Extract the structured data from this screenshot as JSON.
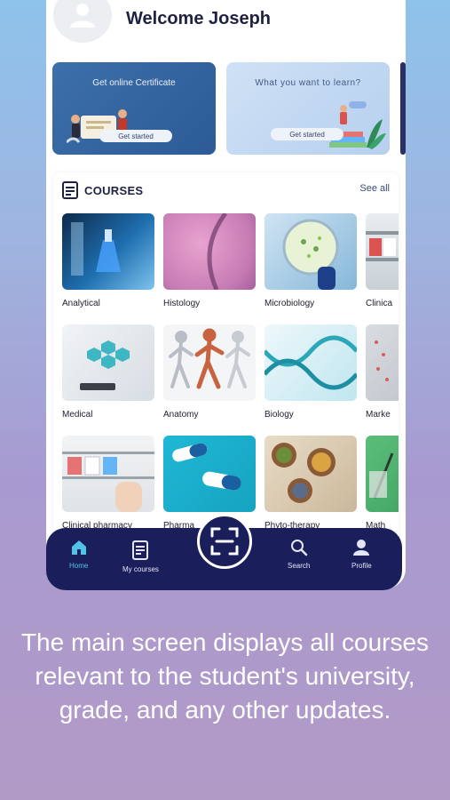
{
  "header": {
    "welcome": "Welcome Joseph"
  },
  "banners": [
    {
      "title": "Get online Certificate",
      "button": "Get started"
    },
    {
      "title": "What you want to learn?",
      "button": "Get started"
    }
  ],
  "courses": {
    "title": "COURSES",
    "see_all": "See all",
    "items": [
      "Analytical",
      "Histology",
      "Microbiology",
      "Clinica",
      "Medical",
      "Anatomy",
      "Biology",
      "Marke",
      "Clinical pharmacy",
      "Pharma",
      "Phyto-therapy",
      "Math"
    ]
  },
  "nav": {
    "home": "Home",
    "my_courses": "My courses",
    "search": "Search",
    "profile": "Profile"
  },
  "caption": "The main screen displays all courses relevant to the student's university, grade, and any other updates.",
  "colors": {
    "nav_bg": "#1a1f5c",
    "active": "#4fc3e8",
    "banner_blue": "#2c5b97"
  }
}
